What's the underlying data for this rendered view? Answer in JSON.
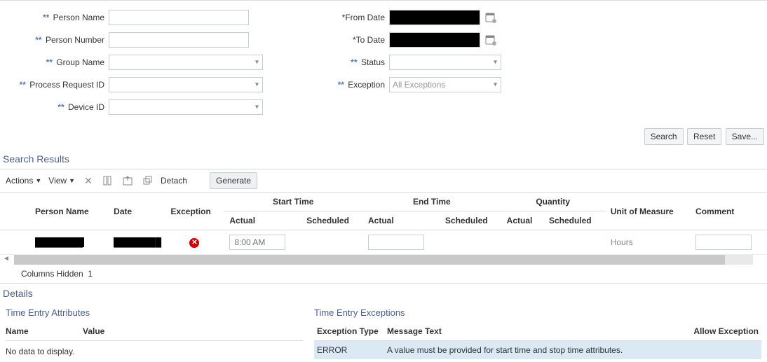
{
  "form": {
    "person_name": {
      "label": "Person Name",
      "value": ""
    },
    "person_number": {
      "label": "Person Number",
      "value": ""
    },
    "group_name": {
      "label": "Group Name",
      "value": ""
    },
    "process_request_id": {
      "label": "Process Request ID",
      "value": ""
    },
    "device_id": {
      "label": "Device ID",
      "value": ""
    },
    "from_date": {
      "label": "From Date",
      "value": "████████"
    },
    "to_date": {
      "label": "To Date",
      "value": "████████"
    },
    "status": {
      "label": "Status",
      "value": ""
    },
    "exception": {
      "label": "Exception",
      "value": "All Exceptions"
    }
  },
  "buttons": {
    "search": "Search",
    "reset": "Reset",
    "save": "Save..."
  },
  "results_title": "Search Results",
  "toolbar": {
    "actions": "Actions",
    "view": "View",
    "detach": "Detach",
    "generate": "Generate"
  },
  "columns": {
    "person_name": "Person Name",
    "date": "Date",
    "exception": "Exception",
    "start_time": "Start Time",
    "end_time": "End Time",
    "quantity": "Quantity",
    "uom": "Unit of Measure",
    "comment": "Comment",
    "actual": "Actual",
    "scheduled": "Scheduled"
  },
  "row": {
    "person_name": "████████",
    "date": "████████",
    "start_actual_placeholder": "8:00 AM",
    "end_actual": "",
    "uom": "Hours",
    "comment": ""
  },
  "columns_hidden": {
    "label": "Columns Hidden",
    "count": "1"
  },
  "details_title": "Details",
  "attributes": {
    "title": "Time Entry Attributes",
    "name": "Name",
    "value": "Value",
    "empty": "No data to display."
  },
  "exceptions": {
    "title": "Time Entry Exceptions",
    "type_hdr": "Exception Type",
    "msg_hdr": "Message Text",
    "allow_hdr": "Allow Exception",
    "rows": [
      {
        "type": "ERROR",
        "msg": "A value must be provided for start time and stop time attributes."
      }
    ]
  }
}
